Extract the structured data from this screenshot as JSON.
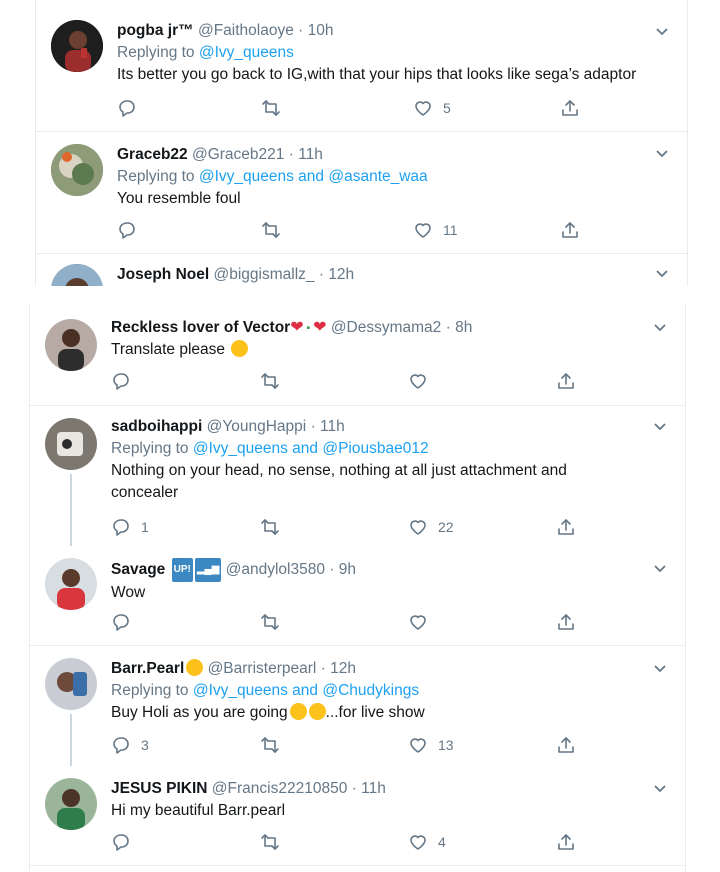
{
  "tweets_top": [
    {
      "name": "pogba jr™",
      "handle": "@Faitholaoye",
      "time": "10h",
      "replying_prefix": "Replying to ",
      "replying_to": "@Ivy_queens",
      "text": "Its better you go back to IG,with that your hips that looks like sega’s adaptor",
      "reply_count": "",
      "retweet_count": "",
      "like_count": "5"
    },
    {
      "name": "Graceb22",
      "handle": "@Graceb221",
      "time": "11h",
      "replying_prefix": "Replying to ",
      "replying_to": "@Ivy_queens and @asante_waa",
      "text": "You resemble foul",
      "reply_count": "",
      "retweet_count": "",
      "like_count": "11"
    },
    {
      "name": "Joseph Noel",
      "handle": "@biggismallz_",
      "time": "12h"
    }
  ],
  "tweets_bottom": [
    {
      "name": "Reckless lover of Vector",
      "handle": "@Dessymama2",
      "time": "8h",
      "text": "Translate please",
      "reply_count": "",
      "retweet_count": "",
      "like_count": ""
    },
    {
      "name": "sadboihappi",
      "handle": "@YoungHappi",
      "time": "11h",
      "replying_prefix": "Replying to ",
      "replying_to": "@Ivy_queens and @Piousbae012",
      "text": "Nothing on your head, no sense, nothing at all just attachment and concealer",
      "reply_count": "1",
      "retweet_count": "",
      "like_count": "22"
    },
    {
      "name": "Savage",
      "badge_up": "UP!",
      "badge_signal": "▂▄▆",
      "handle": "@andylol3580",
      "time": "9h",
      "text": "Wow",
      "reply_count": "",
      "retweet_count": "",
      "like_count": ""
    },
    {
      "name": "Barr.Pearl",
      "handle": "@Barristerpearl",
      "time": "12h",
      "replying_prefix": "Replying to ",
      "replying_to": "@Ivy_queens and @Chudykings",
      "text": "Buy Holi as you are going",
      "text_suffix": "...for live show",
      "reply_count": "3",
      "retweet_count": "",
      "like_count": "13"
    },
    {
      "name": "JESUS PIKIN",
      "handle": "@Francis22210850",
      "time": "11h",
      "text": "Hi my beautiful Barr.pearl",
      "reply_count": "",
      "retweet_count": "",
      "like_count": "4"
    }
  ],
  "meta": {
    "dot": "·"
  },
  "colors": {
    "link": "#1da1f2",
    "muted": "#657786",
    "border": "#e6ecf0",
    "name": "#14171a"
  },
  "icons": [
    "reply-icon",
    "retweet-icon",
    "like-icon",
    "share-icon",
    "chevron-down-icon"
  ]
}
